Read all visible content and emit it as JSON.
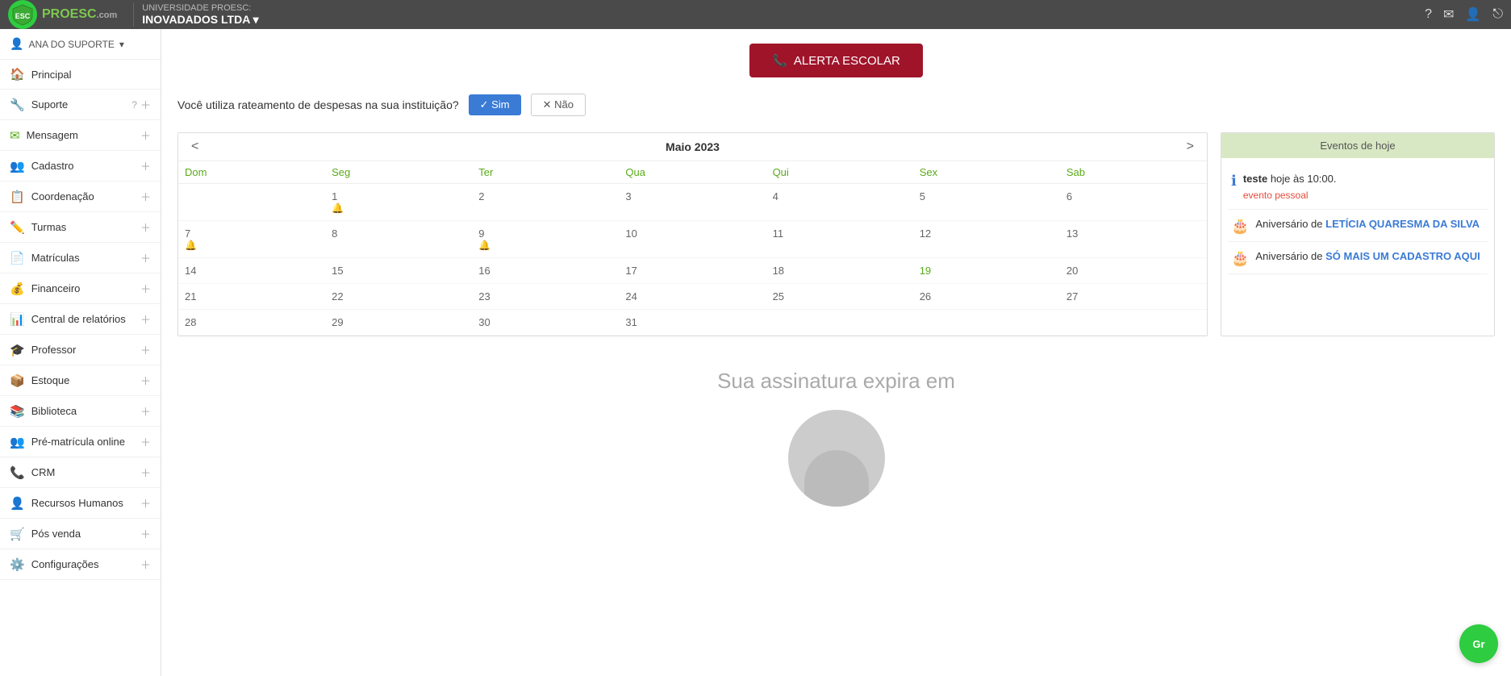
{
  "topbar": {
    "logo_text_pro": "PRO",
    "logo_text_esc": "ESC",
    "logo_sub": ".com",
    "uni_label": "UNIVERSIDADE PROESC:",
    "uni_name": "INOVADADOS LTDA",
    "uni_arrow": "▾",
    "icons": {
      "help": "?",
      "mail": "✉",
      "user": "👤",
      "logout": "⎋"
    }
  },
  "sidebar": {
    "user_name": "ANA DO SUPORTE",
    "user_arrow": "▾",
    "items": [
      {
        "label": "Principal",
        "icon": "🏠",
        "color": "green",
        "expandable": false
      },
      {
        "label": "Suporte",
        "icon": "🔧",
        "color": "green",
        "expandable": true,
        "has_help": true
      },
      {
        "label": "Mensagem",
        "icon": "✉",
        "color": "green",
        "expandable": true
      },
      {
        "label": "Cadastro",
        "icon": "👥",
        "color": "green",
        "expandable": true
      },
      {
        "label": "Coordenação",
        "icon": "📋",
        "color": "green",
        "expandable": true
      },
      {
        "label": "Turmas",
        "icon": "✏️",
        "color": "green",
        "expandable": true
      },
      {
        "label": "Matrículas",
        "icon": "📄",
        "color": "green",
        "expandable": true
      },
      {
        "label": "Financeiro",
        "icon": "💰",
        "color": "green",
        "expandable": true
      },
      {
        "label": "Central de relatórios",
        "icon": "📊",
        "color": "green",
        "expandable": true
      },
      {
        "label": "Professor",
        "icon": "🎓",
        "color": "green",
        "expandable": true
      },
      {
        "label": "Estoque",
        "icon": "📦",
        "color": "green",
        "expandable": true
      },
      {
        "label": "Biblioteca",
        "icon": "📚",
        "color": "green",
        "expandable": true
      },
      {
        "label": "Pré-matrícula online",
        "icon": "👥",
        "color": "green",
        "expandable": true
      },
      {
        "label": "CRM",
        "icon": "📞",
        "color": "green",
        "expandable": true
      },
      {
        "label": "Recursos Humanos",
        "icon": "👤",
        "color": "green",
        "expandable": true
      },
      {
        "label": "Pós venda",
        "icon": "🛒",
        "color": "green",
        "expandable": true
      },
      {
        "label": "Configurações",
        "icon": "⚙️",
        "color": "green",
        "expandable": true
      }
    ]
  },
  "main": {
    "alert_btn": "ALERTA ESCOLAR",
    "phone_icon": "📞",
    "question_text": "Você utiliza rateamento de despesas na sua instituição?",
    "btn_sim": "✓ Sim",
    "btn_nao": "✕ Não",
    "subscription_text": "Sua assinatura expira em",
    "calendar": {
      "month": "Maio 2023",
      "nav_prev": "<",
      "nav_next": ">",
      "headers": [
        "Dom",
        "Seg",
        "Ter",
        "Qua",
        "Qui",
        "Sex",
        "Sab"
      ],
      "weeks": [
        [
          "",
          "1",
          "2",
          "3",
          "4",
          "5",
          "6"
        ],
        [
          "7",
          "8",
          "9",
          "10",
          "11",
          "12",
          "13"
        ],
        [
          "14",
          "15",
          "16",
          "17",
          "18",
          "19",
          "20"
        ],
        [
          "21",
          "22",
          "23",
          "24",
          "25",
          "26",
          "27"
        ],
        [
          "28",
          "29",
          "30",
          "31",
          "",
          "",
          ""
        ]
      ],
      "bell_days": {
        "1": true,
        "9": true,
        "7": true
      }
    }
  },
  "events": {
    "header": "Eventos de hoje",
    "items": [
      {
        "type": "info",
        "icon": "ℹ",
        "name": "teste",
        "time_label": "hoje às 10:00.",
        "sub_label": "evento pessoal"
      },
      {
        "type": "birthday",
        "icon": "🎂",
        "prefix": "Aniversário de",
        "person": "LETÍCIA QUARESMA DA SILVA"
      },
      {
        "type": "birthday",
        "icon": "🎂",
        "prefix": "Aniversário de",
        "person": "SÓ MAIS UM CADASTRO AQUI"
      }
    ]
  },
  "chat": {
    "label": "Gr"
  }
}
